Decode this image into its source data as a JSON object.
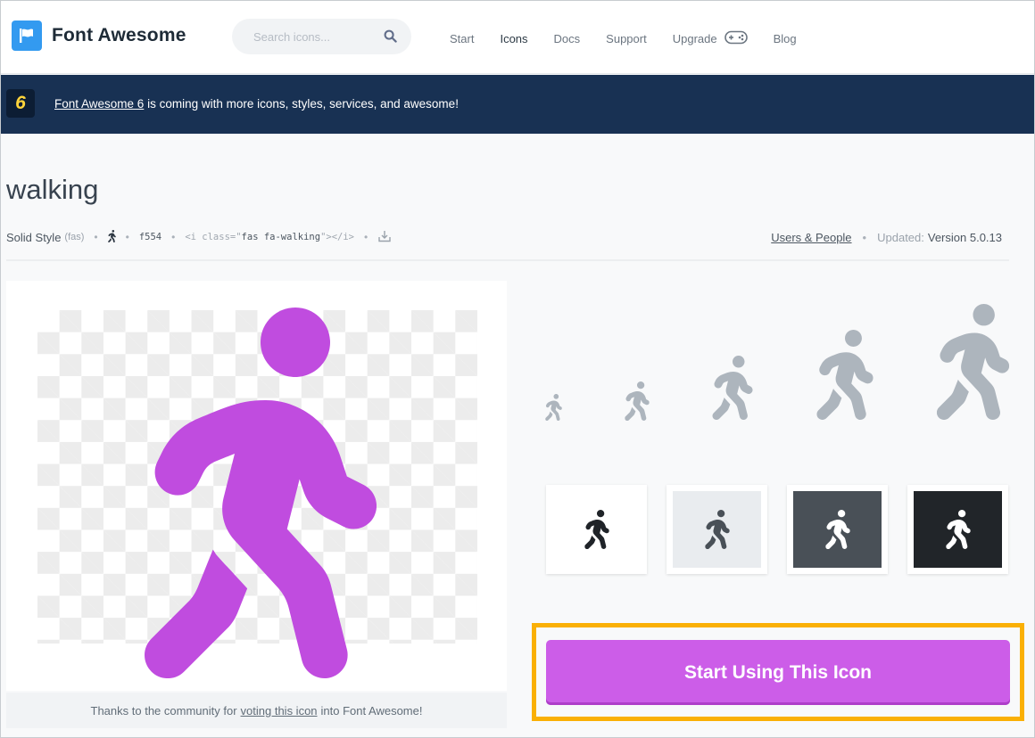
{
  "header": {
    "brand_name": "Font Awesome",
    "search_placeholder": "Search icons...",
    "nav": [
      "Start",
      "Icons",
      "Docs",
      "Support",
      "Upgrade",
      "Blog"
    ],
    "active_nav": "Icons"
  },
  "banner": {
    "badge": "6",
    "link_text": "Font Awesome 6",
    "message": " is coming with more icons, styles, services, and awesome!"
  },
  "icon": {
    "name": "walking",
    "style_label": "Solid Style",
    "style_prefix": "(fas)",
    "unicode": "f554",
    "code_open": "<i class=\"",
    "code_class": "fas fa-walking",
    "code_close": "\"></i>",
    "category": "Users & People",
    "updated_label": "Updated:",
    "version": "Version 5.0.13"
  },
  "preview": {
    "thanks_prefix": "Thanks to the community for",
    "thanks_link": "voting this icon",
    "thanks_suffix": "into Font Awesome!"
  },
  "cta": {
    "label": "Start Using This Icon"
  },
  "colors": {
    "brand_blue": "#339af0",
    "banner_bg": "#183153",
    "accent_purple": "#cc5de8",
    "highlight_yellow": "#fab005",
    "icon_gray": "#adb5bd"
  },
  "icons": {
    "brand": "flag-icon",
    "search": "search-icon",
    "upgrade": "gamepad-icon",
    "glyph": "walking-icon",
    "download": "download-icon"
  }
}
